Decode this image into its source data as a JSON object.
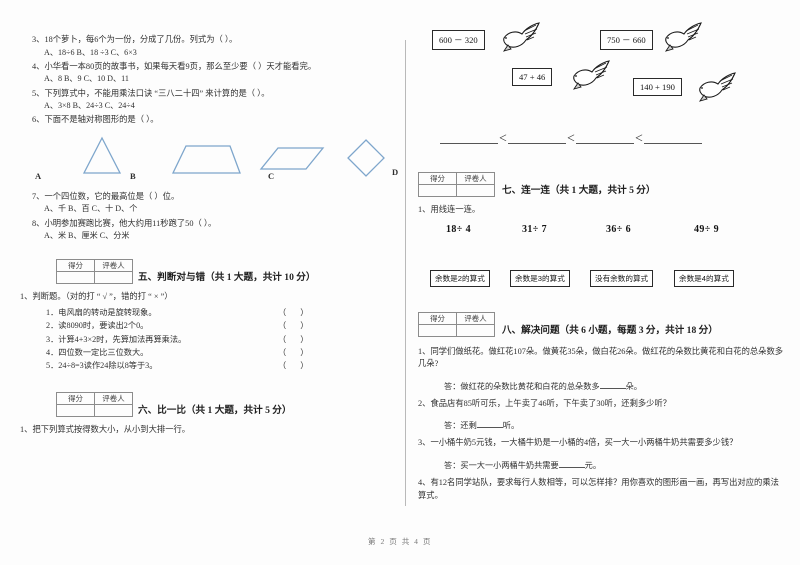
{
  "document": {
    "footer": "第 2 页 共 4 页"
  },
  "left_column": {
    "questions": [
      {
        "text": "3、18个萝卜，每6个为一份，分成了几份。列式为（      ）。",
        "options": "A、18÷6        B、18 ÷3        C、6×3"
      },
      {
        "text": "4、小华看一本80页的故事书，如果每天看9页，那么至少要（      ）天才能看完。",
        "options": "A、8          B、9          C、10          D、11"
      },
      {
        "text": "5、下列算式中，不能用乘法口诀 “三八二十四” 来计算的是（    ）。",
        "options": "A、3×8          B、24÷3          C、24÷4"
      },
      {
        "text": "6、下面不是轴对称图形的是（    ）。",
        "options": ""
      }
    ],
    "shapes": [
      {
        "label": "A",
        "icon": "triangle-shape"
      },
      {
        "label": "B",
        "icon": "trapezoid-shape"
      },
      {
        "label": "C",
        "icon": "parallelogram-shape"
      },
      {
        "label": "D",
        "icon": "diamond-shape"
      }
    ],
    "questions_cont": [
      {
        "text": "7、一个四位数，它的最高位是（      ）位。",
        "options": "A、千          B、百          C、十     D、个"
      },
      {
        "text": "8、小明参加赛跑比赛，他大约用11秒跑了50（     ）。",
        "options": "A、米      B、厘米   C、分米"
      }
    ],
    "section_five": {
      "score_header": [
        "得分",
        "评卷人"
      ],
      "title": "五、判断对与错（共 1 大题，共计 10 分）",
      "prompt": "1、判断题。（对的打 “ √ ”，错的打 “ × ”）",
      "items": [
        "1．电风扇的转动是旋转现象。",
        "2．读8090时，要读出2个0。",
        "3．计算4+3×2时，先算加法再算乘法。",
        "4．四位数一定比三位数大。",
        "5．24÷8=3读作24除以8等于3。"
      ],
      "paren": "（      ）"
    },
    "section_six": {
      "score_header": [
        "得分",
        "评卷人"
      ],
      "title": "六、比一比（共 1 大题，共计 5 分）",
      "prompt": "1、把下列算式按得数大小，从小到大排一行。"
    }
  },
  "right_column": {
    "bird_diagram": {
      "expressions": [
        "600 － 320",
        "47 + 46",
        "750 － 660",
        "140 + 190"
      ],
      "icon": "flying-bird-icon"
    },
    "compare_line": {
      "operator": "＜",
      "blank_count": 4
    },
    "section_seven": {
      "score_header": [
        "得分",
        "评卷人"
      ],
      "title": "七、连一连（共 1 大题，共计 5 分）",
      "prompt": "1、用线连一连。",
      "divisions": [
        "18÷ 4",
        "31÷ 7",
        "36÷ 6",
        "49÷ 9"
      ],
      "tags": [
        "余数是2的算式",
        "余数是3的算式",
        "没有余数的算式",
        "余数是4的算式"
      ]
    },
    "section_eight": {
      "score_header": [
        "得分",
        "评卷人"
      ],
      "title": "八、解决问题（共 6 小题，每题 3 分，共计 18 分）",
      "problems": [
        {
          "text": "1、同学们做纸花。做红花107朵。做黄花35朵，做白花26朵。做红花的朵数比黄花和白花的总朵数多几朵?",
          "answer_prefix": "答：做红花的朵数比黄花和白花的总朵数多",
          "answer_suffix": "朵。"
        },
        {
          "text": "2、食品店有85听可乐，上午卖了46听，下午卖了30听，还剩多少听？",
          "answer_prefix": "答：还剩",
          "answer_suffix": "听。"
        },
        {
          "text": "3、一小桶牛奶5元钱，一大桶牛奶是一小桶的4倍，买一大一小两桶牛奶共需要多少钱？",
          "answer_prefix": "答：买一大一小两桶牛奶共需要",
          "answer_suffix": "元。"
        },
        {
          "text": "4、有12名同学站队，要求每行人数相等，可以怎样排？用你喜欢的图形画一画，再写出对应的乘法算式。",
          "answer_prefix": "",
          "answer_suffix": ""
        }
      ]
    }
  }
}
